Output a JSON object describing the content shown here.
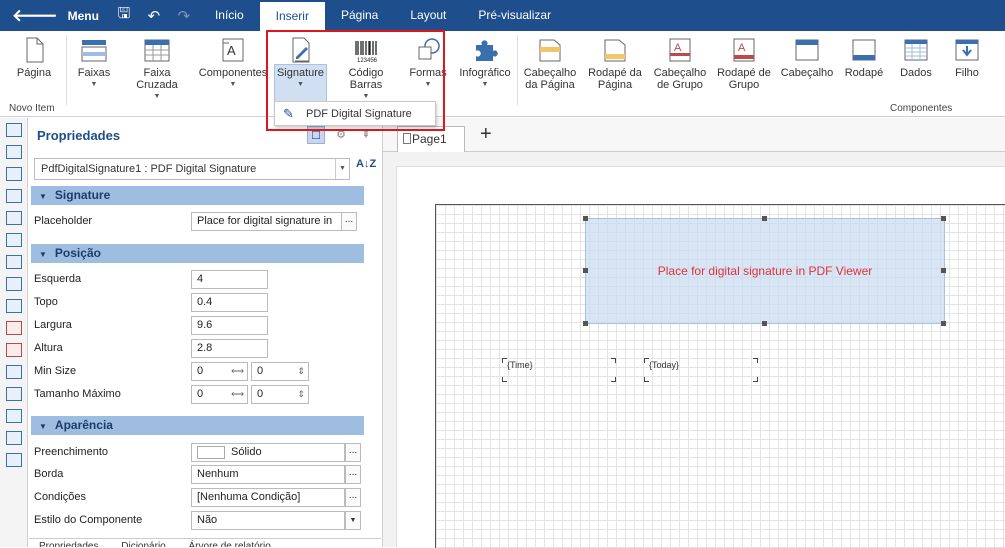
{
  "topbar": {
    "menu_label": "Menu",
    "tabs": [
      "Início",
      "Inserir",
      "Página",
      "Layout",
      "Pré-visualizar"
    ],
    "active_tab": "Inserir"
  },
  "ribbon": {
    "buttons": [
      {
        "label": "Página",
        "label2": ""
      },
      {
        "label": "Faixas",
        "label2": ""
      },
      {
        "label": "Faixa",
        "label2": "Cruzada"
      },
      {
        "label": "Componentes",
        "label2": ""
      },
      {
        "label": "Signature",
        "label2": ""
      },
      {
        "label": "Código",
        "label2": "Barras"
      },
      {
        "label": "Formas",
        "label2": ""
      },
      {
        "label": "Infográfico",
        "label2": ""
      },
      {
        "label": "Cabeçalho",
        "label2": "da Página"
      },
      {
        "label": "Rodapé da",
        "label2": "Página"
      },
      {
        "label": "Cabeçalho",
        "label2": "de Grupo"
      },
      {
        "label": "Rodapé de",
        "label2": "Grupo"
      },
      {
        "label": "Cabeçalho",
        "label2": ""
      },
      {
        "label": "Rodapé",
        "label2": ""
      },
      {
        "label": "Dados",
        "label2": ""
      },
      {
        "label": "Filho",
        "label2": ""
      }
    ],
    "group_new_item": "Novo Item",
    "group_components": "Componentes",
    "dropdown_item": "PDF Digital Signature"
  },
  "properties": {
    "title": "Propriedades",
    "object_selector": "PdfDigitalSignature1 : PDF Digital Signature",
    "sort_icon_text": "A↓Z",
    "sections": {
      "signature": "Signature",
      "position": "Posição",
      "appearance": "Aparência"
    },
    "placeholder_label": "Placeholder",
    "placeholder_value": "Place for digital signature in",
    "left_label": "Esquerda",
    "left_value": "4",
    "top_label": "Topo",
    "top_value": "0.4",
    "width_label": "Largura",
    "width_value": "9.6",
    "height_label": "Altura",
    "height_value": "2.8",
    "minsize_label": "Min Size",
    "minsize_w": "0",
    "minsize_h": "0",
    "maxsize_label": "Tamanho Máximo",
    "maxsize_w": "0",
    "maxsize_h": "0",
    "fill_label": "Preenchimento",
    "fill_value": "Sólido",
    "border_label": "Borda",
    "border_value": "Nenhum",
    "conditions_label": "Condições",
    "conditions_value": "[Nenhuma Condição]",
    "style_label": "Estilo do Componente",
    "style_value": "Não",
    "bottom_tabs": [
      "Propriedades",
      "Dicionário",
      "Árvore de relatório"
    ]
  },
  "design": {
    "page_tab": "Page1",
    "add_label": "+",
    "signature_text": "Place for digital signature in PDF Viewer",
    "time_field": "{Time}",
    "today_field": "{Today}"
  }
}
